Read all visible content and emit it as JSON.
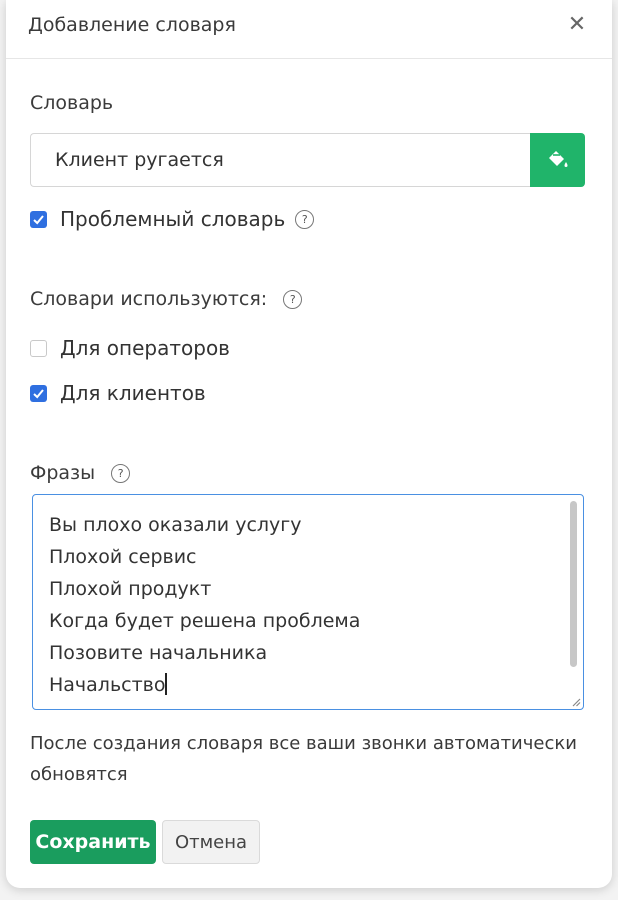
{
  "dialog": {
    "title": "Добавление словаря",
    "close_icon": "close-icon",
    "dictionary_label": "Словарь",
    "dictionary_value": "Клиент ругается",
    "fill_button_icon": "paint-bucket-icon",
    "problem_checkbox": {
      "label": "Проблемный словарь",
      "checked": true
    },
    "usage_label": "Словари используются:",
    "usage_options": [
      {
        "label": "Для операторов",
        "checked": false
      },
      {
        "label": "Для клиентов",
        "checked": true
      }
    ],
    "phrases_label": "Фразы",
    "phrases": [
      "Вы плохо оказали услугу",
      "Плохой сервис",
      "Плохой продукт",
      "Когда будет решена проблема",
      "Позовите начальника",
      "Начальство"
    ],
    "note": "После создания словаря все ваши звонки автоматически обновятся",
    "save_label": "Сохранить",
    "cancel_label": "Отмена",
    "help_icon": "help-circle-icon",
    "colors": {
      "accent_green": "#20b46a",
      "save_green": "#1a9d5e",
      "checkbox_blue": "#2f6fe0",
      "focus_blue": "#4a90e2"
    }
  }
}
